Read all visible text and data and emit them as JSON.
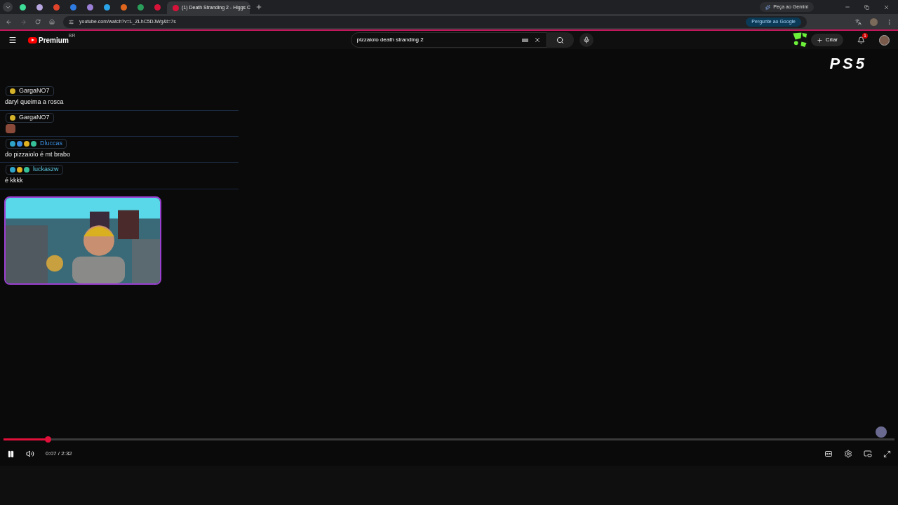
{
  "browser": {
    "tabs": [
      {
        "color": "#3ddc97",
        "selected": false
      },
      {
        "color": "#b8a6e0",
        "selected": false
      },
      {
        "color": "#e0442a",
        "selected": false
      },
      {
        "color": "#2f7be0",
        "selected": false
      },
      {
        "color": "#9b7fd6",
        "selected": false
      },
      {
        "color": "#2aa3e8",
        "selected": false
      },
      {
        "color": "#e0661e",
        "selected": false
      },
      {
        "color": "#2a9d5a",
        "selected": false
      },
      {
        "color": "#d8133a",
        "selected": false
      },
      {
        "color": "#d8133a",
        "selected": true,
        "title": "(1) Death Stranding 2 - Higgs C"
      }
    ],
    "gemini": "Peça ao Gemini",
    "url": "youtube.com/watch?v=L_ZLhC5DJWg&t=7s",
    "ask_google": "Pergunte ao Google"
  },
  "youtube": {
    "logo": "Premium",
    "region": "BR",
    "search": "pizzaiolo death stranding 2",
    "create": "Criar",
    "notifications": "1"
  },
  "video": {
    "ps5": "PS5",
    "chat": [
      {
        "user": "GargaNO7",
        "kind": "gold",
        "badges": [
          {
            "color": "#d4b22a"
          }
        ],
        "message": "daryl queima a rosca"
      },
      {
        "user": "GargaNO7",
        "kind": "gold",
        "badges": [
          {
            "color": "#d4b22a"
          }
        ]
      },
      {
        "user": "Dluccas",
        "kind": "blue",
        "badges": [
          {
            "color": "#2fa3c8"
          },
          {
            "color": "#3b8be0"
          },
          {
            "color": "#e0b020"
          },
          {
            "color": "#36c09a"
          }
        ],
        "message": "do pizzaiolo é mt brabo"
      },
      {
        "user": "luckaszw",
        "kind": "cyan",
        "badges": [
          {
            "color": "#2fa3c8"
          },
          {
            "color": "#e0b020"
          },
          {
            "color": "#36c09a"
          }
        ],
        "message": "é kkkk"
      }
    ],
    "time": "0:07 / 2:32",
    "playing": true
  }
}
